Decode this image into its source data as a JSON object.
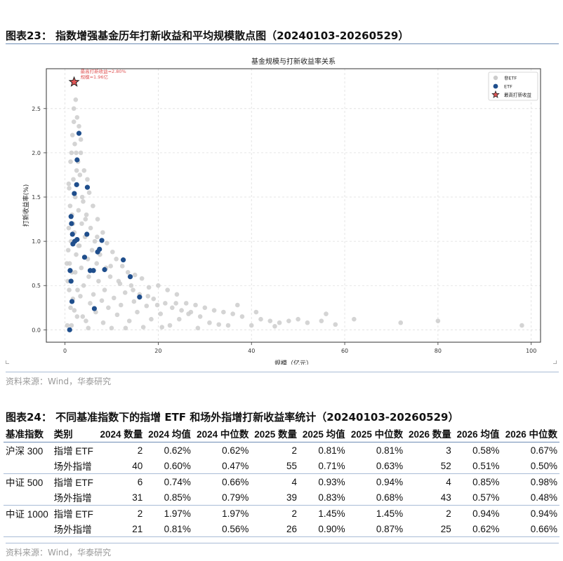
{
  "figure23": {
    "title": "图表23：  指数增强基金历年打新收益和平均规模散点图（20240103-20260529）",
    "source": "资料来源：Wind，华泰研究"
  },
  "chart_data": {
    "type": "scatter",
    "title": "基金规模与打新收益率关系",
    "xlabel": "规模（亿元）",
    "ylabel": "打新收益率(%)",
    "xlim": [
      -4,
      102
    ],
    "ylim": [
      -0.14,
      2.95
    ],
    "xticks": [
      "0",
      "20",
      "40",
      "60",
      "80",
      "100"
    ],
    "yticks": [
      "0.0",
      "0.5",
      "1.0",
      "1.5",
      "2.0",
      "2.5"
    ],
    "xtick_values": [
      0,
      20,
      40,
      60,
      80,
      100
    ],
    "ytick_values": [
      0,
      0.5,
      1.0,
      1.5,
      2.0,
      2.5
    ],
    "grid": true,
    "legend_position": "top-right",
    "colors": {
      "non_etf": "#cccccc",
      "etf": "#1f4e8c",
      "max": "#e05555"
    },
    "annotation": {
      "line1": "最高打新收益≈2.80%",
      "line2": "规模≈1.96亿"
    },
    "series": [
      {
        "name": "非ETF",
        "points": [
          [
            2.3,
            2.6
          ],
          [
            1.9,
            2.5
          ],
          [
            2.6,
            2.4
          ],
          [
            3.0,
            2.3
          ],
          [
            1.6,
            2.2
          ],
          [
            2.1,
            2.1
          ],
          [
            1.4,
            2.0
          ],
          [
            3.4,
            2.0
          ],
          [
            2.8,
            1.9
          ],
          [
            1.2,
            1.9
          ],
          [
            4.1,
            1.8
          ],
          [
            2.5,
            1.8
          ],
          [
            1.8,
            1.7
          ],
          [
            3.2,
            1.75
          ],
          [
            0.9,
            1.6
          ],
          [
            5.2,
            1.55
          ],
          [
            2.2,
            1.5
          ],
          [
            3.9,
            1.45
          ],
          [
            1.1,
            1.4
          ],
          [
            6.0,
            1.4
          ],
          [
            2.9,
            1.35
          ],
          [
            4.6,
            1.3
          ],
          [
            1.5,
            1.3
          ],
          [
            7.0,
            1.25
          ],
          [
            3.6,
            1.2
          ],
          [
            0.8,
            1.15
          ],
          [
            5.5,
            1.15
          ],
          [
            2.0,
            1.1
          ],
          [
            8.1,
            1.1
          ],
          [
            4.3,
            1.05
          ],
          [
            1.3,
            1.0
          ],
          [
            6.4,
            1.0
          ],
          [
            9.0,
            0.98
          ],
          [
            3.1,
            0.95
          ],
          [
            0.7,
            0.9
          ],
          [
            5.8,
            0.9
          ],
          [
            10.2,
            0.88
          ],
          [
            2.4,
            0.85
          ],
          [
            7.5,
            0.85
          ],
          [
            4.9,
            0.8
          ],
          [
            11.0,
            0.8
          ],
          [
            1.0,
            0.75
          ],
          [
            6.8,
            0.75
          ],
          [
            12.3,
            0.72
          ],
          [
            3.5,
            0.7
          ],
          [
            8.8,
            0.7
          ],
          [
            13.5,
            0.65
          ],
          [
            2.2,
            0.65
          ],
          [
            15.0,
            0.62
          ],
          [
            5.1,
            0.6
          ],
          [
            9.7,
            0.6
          ],
          [
            16.5,
            0.58
          ],
          [
            0.6,
            0.55
          ],
          [
            7.2,
            0.55
          ],
          [
            11.8,
            0.52
          ],
          [
            4.0,
            0.5
          ],
          [
            14.2,
            0.5
          ],
          [
            18.0,
            0.48
          ],
          [
            2.7,
            0.45
          ],
          [
            8.5,
            0.45
          ],
          [
            12.9,
            0.42
          ],
          [
            20.0,
            0.5
          ],
          [
            6.1,
            0.4
          ],
          [
            16.0,
            0.4
          ],
          [
            22.0,
            0.45
          ],
          [
            3.3,
            0.38
          ],
          [
            10.5,
            0.36
          ],
          [
            24.0,
            0.4
          ],
          [
            19.0,
            0.35
          ],
          [
            1.7,
            0.35
          ],
          [
            7.9,
            0.33
          ],
          [
            14.8,
            0.32
          ],
          [
            26.0,
            0.3
          ],
          [
            21.5,
            0.3
          ],
          [
            5.4,
            0.3
          ],
          [
            12.0,
            0.28
          ],
          [
            28.0,
            0.28
          ],
          [
            17.5,
            0.27
          ],
          [
            23.0,
            0.25
          ],
          [
            30.0,
            0.25
          ],
          [
            9.3,
            0.25
          ],
          [
            25.0,
            0.22
          ],
          [
            2.0,
            0.22
          ],
          [
            32.0,
            0.22
          ],
          [
            15.5,
            0.2
          ],
          [
            27.0,
            0.2
          ],
          [
            34.0,
            0.2
          ],
          [
            6.6,
            0.2
          ],
          [
            20.5,
            0.18
          ],
          [
            36.0,
            0.18
          ],
          [
            11.2,
            0.17
          ],
          [
            29.0,
            0.15
          ],
          [
            38.0,
            0.15
          ],
          [
            3.8,
            0.15
          ],
          [
            24.5,
            0.12
          ],
          [
            42.0,
            0.12
          ],
          [
            18.5,
            0.12
          ],
          [
            44.0,
            0.1
          ],
          [
            13.8,
            0.1
          ],
          [
            46.0,
            0.08
          ],
          [
            31.0,
            0.08
          ],
          [
            48.0,
            0.1
          ],
          [
            8.2,
            0.08
          ],
          [
            50.0,
            0.12
          ],
          [
            35.0,
            0.05
          ],
          [
            52.0,
            0.08
          ],
          [
            22.5,
            0.05
          ],
          [
            55.0,
            0.1
          ],
          [
            40.0,
            0.05
          ],
          [
            58.0,
            0.06
          ],
          [
            1.4,
            0.05
          ],
          [
            62.0,
            0.12
          ],
          [
            16.8,
            0.03
          ],
          [
            45.0,
            0.04
          ],
          [
            72.0,
            0.08
          ],
          [
            10.0,
            0.02
          ],
          [
            80.0,
            0.1
          ],
          [
            28.5,
            0.02
          ],
          [
            98.0,
            0.05
          ],
          [
            5.0,
            0.02
          ],
          [
            0.5,
            0.05
          ],
          [
            13.0,
            0.02
          ],
          [
            20.8,
            0.03
          ],
          [
            33.0,
            0.06
          ],
          [
            4.5,
            0.1
          ],
          [
            2.6,
            0.15
          ],
          [
            1.2,
            0.25
          ],
          [
            0.9,
            0.45
          ],
          [
            1.5,
            0.65
          ],
          [
            0.4,
            0.75
          ],
          [
            2.9,
            0.95
          ],
          [
            1.7,
            1.2
          ],
          [
            3.7,
            1.5
          ],
          [
            0.8,
            1.65
          ],
          [
            4.8,
            1.7
          ],
          [
            2.4,
            2.0
          ],
          [
            3.4,
            2.15
          ],
          [
            1.9,
            2.35
          ],
          [
            4.4,
            1.25
          ],
          [
            6.9,
            1.05
          ],
          [
            9.8,
            0.72
          ],
          [
            11.5,
            0.55
          ],
          [
            14.6,
            0.45
          ],
          [
            17.8,
            0.38
          ],
          [
            19.8,
            0.28
          ],
          [
            23.8,
            0.3
          ],
          [
            26.5,
            0.18
          ],
          [
            37.0,
            0.28
          ],
          [
            41.0,
            0.2
          ],
          [
            56.0,
            0.18
          ]
        ]
      },
      {
        "name": "ETF",
        "points": [
          [
            3.0,
            2.22
          ],
          [
            2.6,
            1.92
          ],
          [
            4.8,
            1.61
          ],
          [
            2.5,
            1.64
          ],
          [
            2.0,
            1.54
          ],
          [
            1.3,
            1.28
          ],
          [
            1.4,
            1.2
          ],
          [
            1.6,
            1.08
          ],
          [
            4.7,
            1.08
          ],
          [
            2.1,
            1.0
          ],
          [
            2.6,
            1.02
          ],
          [
            1.7,
            0.97
          ],
          [
            7.9,
            1.01
          ],
          [
            7.4,
            0.91
          ],
          [
            7.0,
            0.88
          ],
          [
            4.2,
            0.82
          ],
          [
            12.5,
            0.79
          ],
          [
            8.5,
            0.68
          ],
          [
            5.4,
            0.67
          ],
          [
            6.1,
            0.67
          ],
          [
            1.1,
            0.67
          ],
          [
            14.0,
            0.6
          ],
          [
            1.3,
            0.55
          ],
          [
            16.0,
            0.37
          ],
          [
            1.5,
            0.32
          ],
          [
            6.3,
            0.24
          ],
          [
            1.0,
            0.0
          ]
        ]
      },
      {
        "name": "最高打新收益",
        "points": [
          [
            1.96,
            2.8
          ]
        ]
      }
    ]
  },
  "figure24": {
    "title": "图表24：  不同基准指数下的指增 ETF 和场外指增打新收益率统计（20240103-20260529）",
    "source": "资料来源：Wind，华泰研究",
    "headers": [
      "基准指数",
      "类别",
      "2024 数量",
      "2024 均值",
      "2024 中位数",
      "2025 数量",
      "2025 均值",
      "2025 中位数",
      "2026 数量",
      "2026 均值",
      "2026 中位数"
    ],
    "rows": [
      [
        "沪深 300",
        "指增 ETF",
        "2",
        "0.62%",
        "0.62%",
        "2",
        "0.81%",
        "0.81%",
        "3",
        "0.58%",
        "0.67%"
      ],
      [
        "",
        "场外指增",
        "40",
        "0.60%",
        "0.47%",
        "55",
        "0.71%",
        "0.63%",
        "52",
        "0.51%",
        "0.50%"
      ],
      [
        "中证 500",
        "指增 ETF",
        "6",
        "0.74%",
        "0.66%",
        "4",
        "0.93%",
        "0.94%",
        "4",
        "0.85%",
        "0.98%"
      ],
      [
        "",
        "场外指增",
        "31",
        "0.85%",
        "0.79%",
        "39",
        "0.83%",
        "0.68%",
        "43",
        "0.57%",
        "0.48%"
      ],
      [
        "中证 1000",
        "指增 ETF",
        "2",
        "1.97%",
        "1.97%",
        "2",
        "1.45%",
        "1.45%",
        "2",
        "0.94%",
        "0.94%"
      ],
      [
        "",
        "场外指增",
        "21",
        "0.81%",
        "0.56%",
        "26",
        "0.90%",
        "0.87%",
        "25",
        "0.62%",
        "0.66%"
      ]
    ]
  }
}
